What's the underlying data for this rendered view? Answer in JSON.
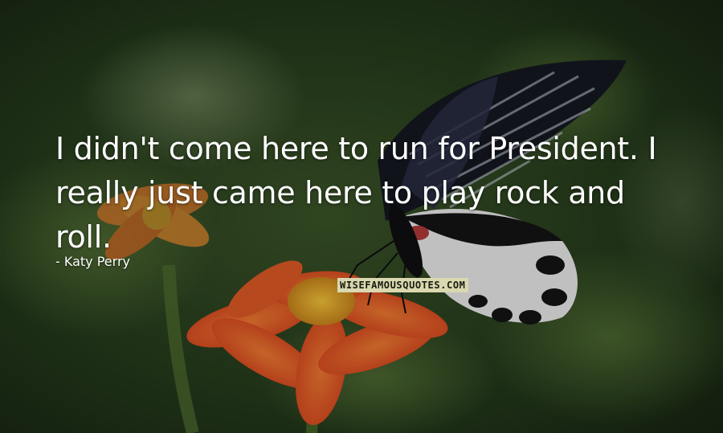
{
  "quote": {
    "text": "I didn't come here to run for President. I really just came here to play rock and roll."
  },
  "author": {
    "dash": "-",
    "name": "Katy Perry"
  },
  "watermark": {
    "text": "WISEFAMOUSQUOTES.COM"
  },
  "colors": {
    "text": "#ffffff",
    "watermark_bg": "#d9d8b0",
    "foliage": "#2f4a22",
    "flower_orange": "#e8532a",
    "butterfly_dark": "#1a1a24"
  }
}
